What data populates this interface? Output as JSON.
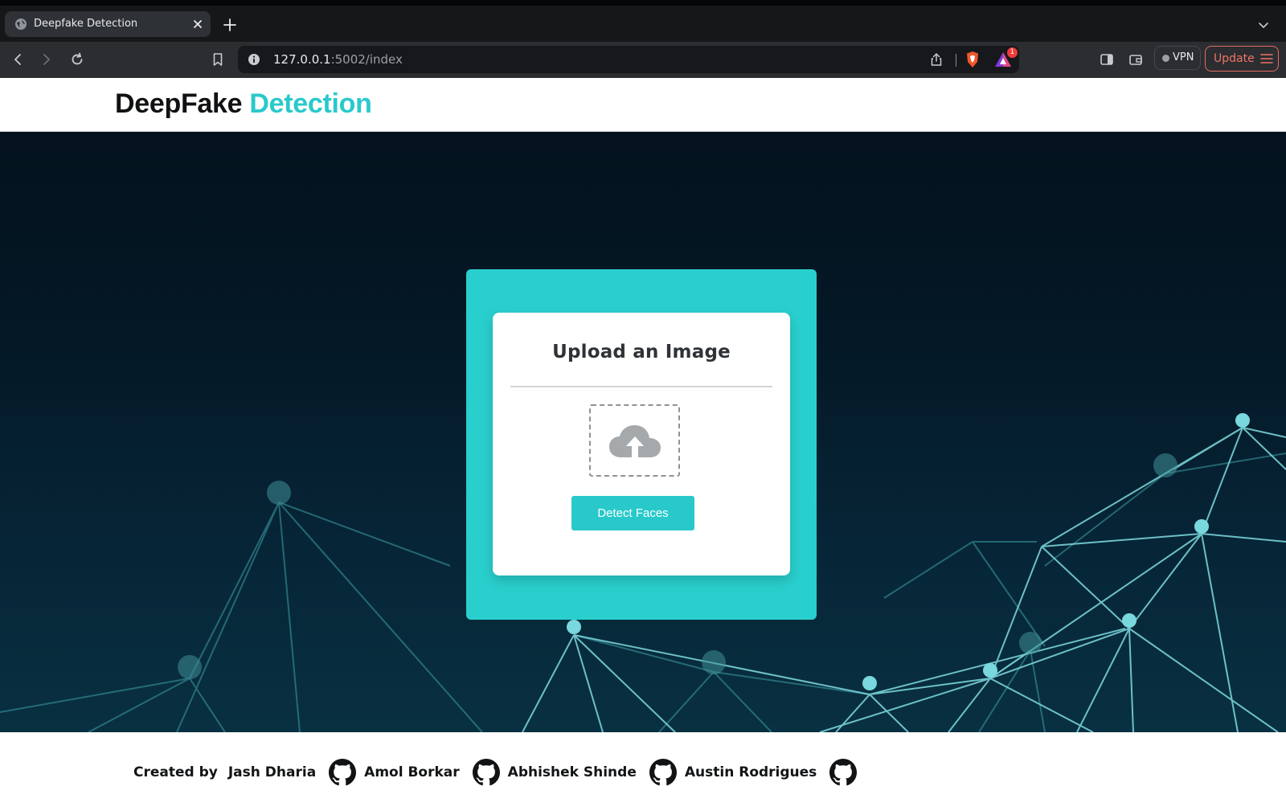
{
  "browser": {
    "tab": {
      "title": "Deepfake Detection"
    },
    "url": {
      "host": "127.0.0.1",
      "path": ":5002/index"
    },
    "rewards_badge": "1",
    "vpn_label": "VPN",
    "update_label": "Update"
  },
  "header": {
    "brand_part1": "DeepFake",
    "brand_part2": "Detection"
  },
  "upload": {
    "title": "Upload an Image",
    "button_label": "Detect Faces"
  },
  "footer": {
    "created_by": "Created by",
    "authors": [
      "Jash Dharia",
      "Amol Borkar",
      "Abhishek Shinde",
      "Austin Rodrigues"
    ]
  },
  "colors": {
    "accent": "#29c9cb",
    "hero_dark": "#03121d",
    "update_red": "#f07566"
  },
  "icons": {
    "upload_zone": "cloud-upload-icon",
    "author_link": "github-icon"
  }
}
